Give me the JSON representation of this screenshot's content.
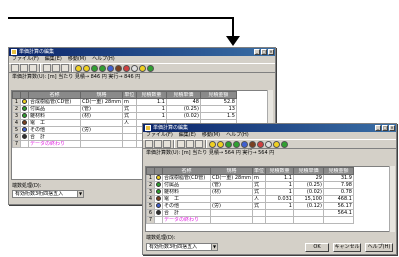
{
  "window": {
    "title": "単価計算の編集",
    "menu": [
      "ファイル(F)",
      "編集(E)",
      "移動(M)",
      "ヘルプ(H)"
    ]
  },
  "back": {
    "info": {
      "unit_label": "単価計算数(U):",
      "unit_value": "[m] 当たり",
      "estimate": "見積→ 846 円",
      "actual": "実行→ 846 円"
    },
    "headers": [
      "",
      "",
      "名称",
      "規格",
      "単位",
      "見積数量",
      "見積単価",
      "見積金額"
    ],
    "rows": [
      {
        "no": "1",
        "icon_color": "#f0d020",
        "name": "合成樹脂管(CD管)",
        "spec": "CD(一重) 28mm",
        "unit": "m",
        "qty": "1.1",
        "price": "48",
        "amount": "52.8"
      },
      {
        "no": "2",
        "icon_color": "#30a030",
        "name": "付属品",
        "spec": "(管)",
        "unit": "式",
        "qty": "1",
        "price": "(0.25)",
        "amount": "13"
      },
      {
        "no": "3",
        "icon_color": "#30a030",
        "name": "雑材料",
        "spec": "(材)",
        "unit": "式",
        "qty": "1",
        "price": "(0.02)",
        "amount": "1.5"
      },
      {
        "no": "4",
        "icon_color": "#7a4020",
        "name": "電　工",
        "spec": "",
        "unit": "人",
        "qty": "",
        "price": "",
        "amount": ""
      },
      {
        "no": "5",
        "icon_color": "#4060d0",
        "name": "その他",
        "spec": "(労)",
        "unit": "",
        "qty": "",
        "price": "",
        "amount": ""
      },
      {
        "no": "6",
        "icon_color": "#303030",
        "name": "合　計",
        "spec": "",
        "unit": "",
        "qty": "",
        "price": "",
        "amount": ""
      },
      {
        "no": "7",
        "icon_color": "",
        "name": "データの終わり",
        "spec": "",
        "unit": "",
        "qty": "",
        "price": "",
        "amount": ""
      }
    ],
    "rounding_label": "端数処理(D):",
    "rounding_value": "有効桁数3桁四捨五入"
  },
  "front": {
    "info": {
      "unit_label": "単価計算数(U):",
      "unit_value": "[m] 当たり",
      "estimate": "見積→ 564 円",
      "actual": "実行→ 564 円"
    },
    "headers": [
      "",
      "",
      "名称",
      "規格",
      "単位",
      "見積数量",
      "見積単価",
      "見積金額"
    ],
    "rows": [
      {
        "no": "1",
        "icon_color": "#f0d020",
        "name": "合成樹脂管(CD管)",
        "spec": "CD(一重) 28mm",
        "unit": "m",
        "qty": "1.1",
        "price": "29",
        "amount": "31.9"
      },
      {
        "no": "2",
        "icon_color": "#30a030",
        "name": "付属品",
        "spec": "(管)",
        "unit": "式",
        "qty": "1",
        "price": "(0.25)",
        "amount": "7.98"
      },
      {
        "no": "3",
        "icon_color": "#30a030",
        "name": "雑材料",
        "spec": "(材)",
        "unit": "式",
        "qty": "1",
        "price": "(0.02)",
        "amount": "0.78"
      },
      {
        "no": "4",
        "icon_color": "#7a4020",
        "name": "電　工",
        "spec": "",
        "unit": "人",
        "qty": "0.031",
        "price": "15,100",
        "amount": "468.1"
      },
      {
        "no": "5",
        "icon_color": "#4060d0",
        "name": "その他",
        "spec": "(労)",
        "unit": "式",
        "qty": "1",
        "price": "(0.12)",
        "amount": "56.17"
      },
      {
        "no": "6",
        "icon_color": "#303030",
        "name": "合　計",
        "spec": "",
        "unit": "",
        "qty": "",
        "price": "",
        "amount": "564.1"
      },
      {
        "no": "7",
        "icon_color": "",
        "name": "データの終わり",
        "spec": "",
        "unit": "",
        "qty": "",
        "price": "",
        "amount": ""
      }
    ],
    "rounding_label": "端数処理(D):",
    "rounding_value": "有効桁数3桁四捨五入",
    "buttons": {
      "ok": "OK",
      "cancel": "キャンセル",
      "help": "ヘルプ(H)"
    }
  },
  "toolbar_colors": [
    "#f0d020",
    "#f0d020",
    "#30a030",
    "#30a030",
    "#4060d0",
    "#7a4020",
    "#d04040",
    "#e0e0e0",
    "#f0d020",
    "#30a030"
  ],
  "accent": {
    "titlebar": "#0a246a",
    "data_end": "#e020e0",
    "arrow": "#000000"
  }
}
